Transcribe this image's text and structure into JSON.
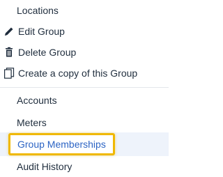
{
  "menu": {
    "locations": "Locations",
    "edit_group": "Edit Group",
    "delete_group": "Delete Group",
    "copy_group": "Create a copy of this Group",
    "accounts": "Accounts",
    "meters": "Meters",
    "group_memberships": "Group Memberships",
    "audit_history": "Audit History"
  },
  "colors": {
    "text": "#1f2d3d",
    "active_text": "#2c64c4",
    "active_bg": "#eef3fb",
    "highlight_border": "#f0b800",
    "divider": "#e3e6ea"
  },
  "icons": {
    "edit": "pencil-icon",
    "delete": "trash-icon",
    "copy": "copy-icon"
  }
}
